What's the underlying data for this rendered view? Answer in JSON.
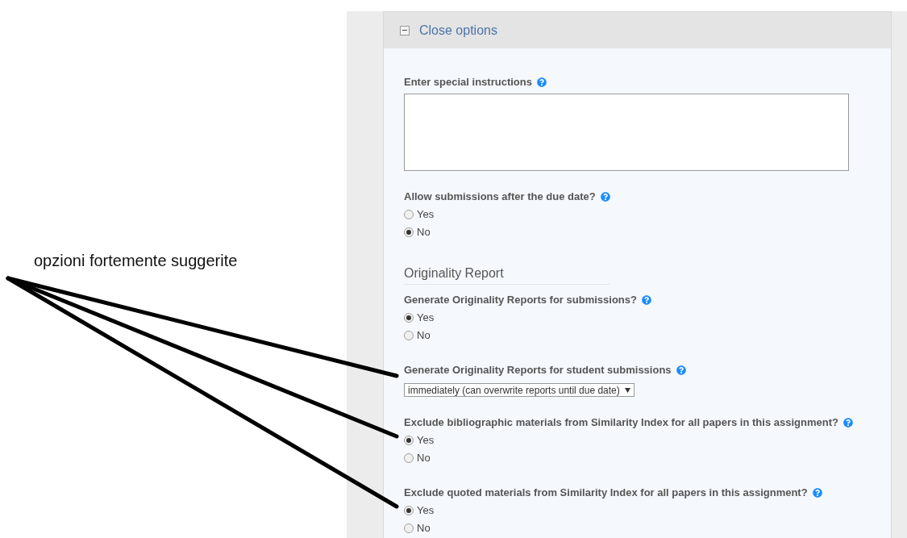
{
  "annotation": {
    "text": "opzioni fortemente suggerite"
  },
  "panel": {
    "title": "Close options",
    "expanded": true
  },
  "fields": [
    {
      "kind": "textarea",
      "label": "Enter special instructions",
      "help": true
    },
    {
      "kind": "radio",
      "label": "Allow submissions after the due date?",
      "help": true,
      "options": [
        {
          "label": "Yes",
          "selected": false
        },
        {
          "label": "No",
          "selected": true
        }
      ]
    },
    {
      "kind": "heading",
      "label": "Originality Report"
    },
    {
      "kind": "radio",
      "label": "Generate Originality Reports for submissions?",
      "help": true,
      "options": [
        {
          "label": "Yes",
          "selected": true
        },
        {
          "label": "No",
          "selected": false
        }
      ]
    },
    {
      "kind": "select",
      "label": "Generate Originality Reports for student submissions",
      "help": true,
      "value": "immediately (can overwrite reports until due date)"
    },
    {
      "kind": "radio",
      "label": "Exclude bibliographic materials from Similarity Index for all papers in this assignment?",
      "help": true,
      "options": [
        {
          "label": "Yes",
          "selected": true
        },
        {
          "label": "No",
          "selected": false
        }
      ]
    },
    {
      "kind": "radio",
      "label": "Exclude quoted materials from Similarity Index for all papers in this assignment?",
      "help": true,
      "options": [
        {
          "label": "Yes",
          "selected": true
        },
        {
          "label": "No",
          "selected": false
        }
      ]
    }
  ]
}
